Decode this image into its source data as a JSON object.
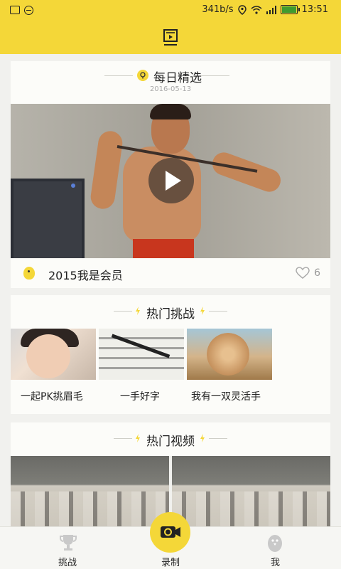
{
  "status_bar": {
    "network_speed": "341b/s",
    "time": "13:51"
  },
  "header": {
    "icon": "video-channel-icon"
  },
  "daily_pick": {
    "title": "每日精选",
    "date": "2016-05-13",
    "video": {
      "caption": "2015我是会员",
      "likes": "6"
    }
  },
  "hot_challenges": {
    "title": "热门挑战",
    "items": [
      {
        "label": "一起PK挑眉毛"
      },
      {
        "label": "一手好字"
      },
      {
        "label": "我有一双灵活手"
      }
    ]
  },
  "hot_videos": {
    "title": "热门视频"
  },
  "tabbar": {
    "items": [
      {
        "label": "挑战",
        "icon": "trophy-icon"
      },
      {
        "label": "录制",
        "icon": "camera-icon"
      },
      {
        "label": "我",
        "icon": "chick-icon"
      }
    ]
  },
  "colors": {
    "accent": "#f4d738"
  }
}
